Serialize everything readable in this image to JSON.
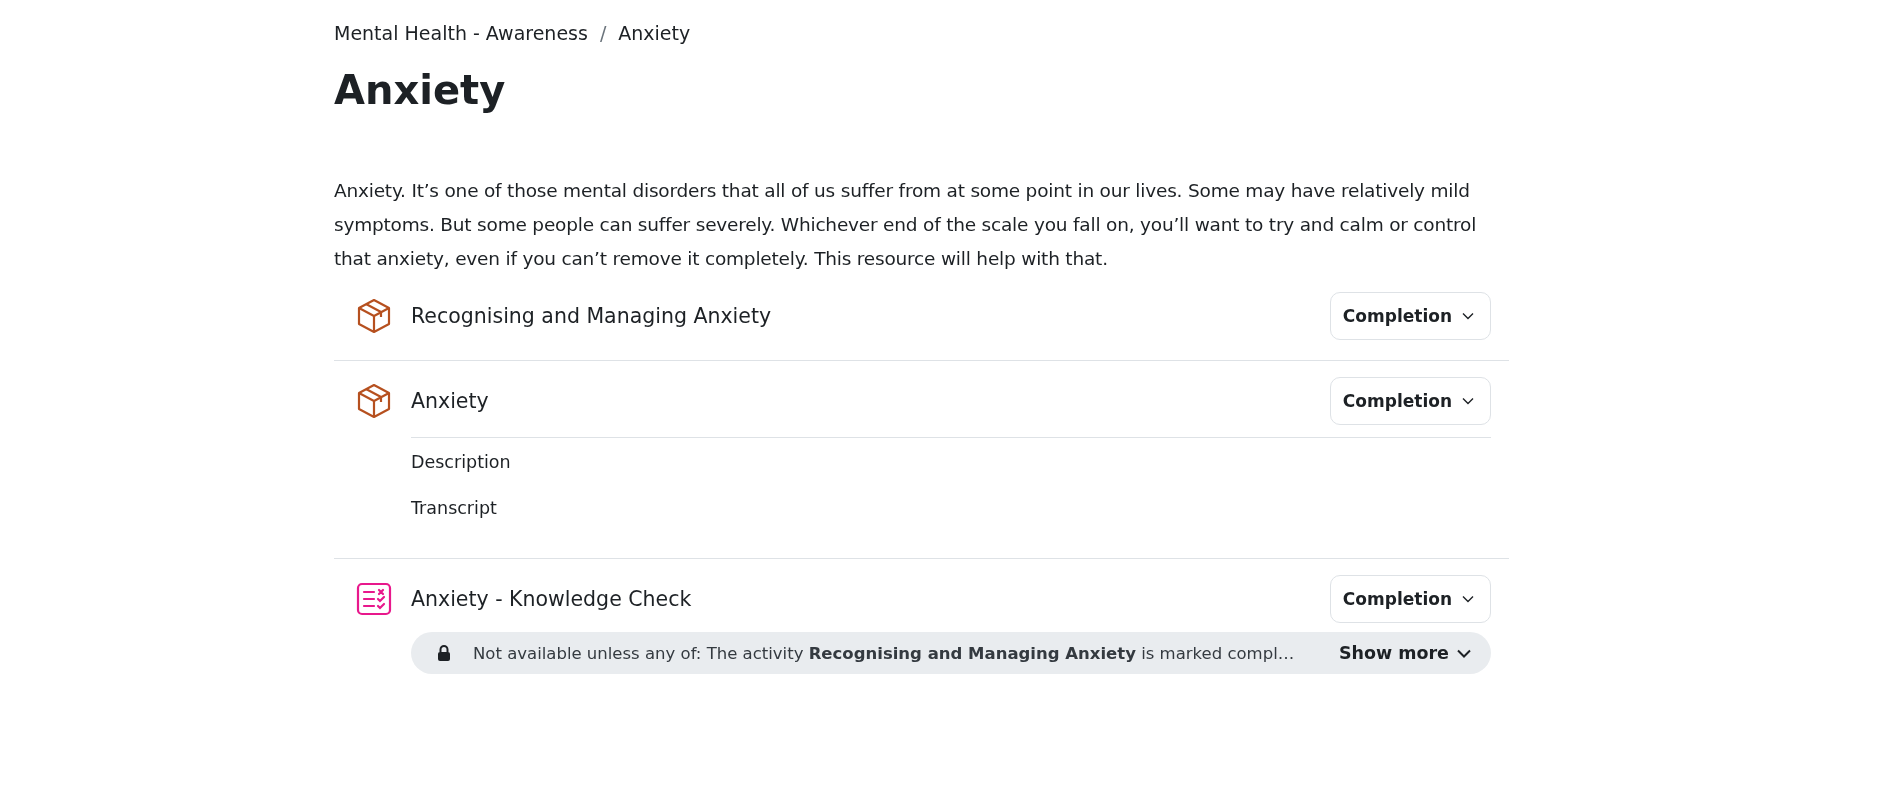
{
  "breadcrumb": {
    "items": [
      "Mental Health - Awareness",
      "Anxiety"
    ],
    "separator": "/"
  },
  "title": "Anxiety",
  "intro": "Anxiety. It’s one of those mental disorders that all of us suffer from at some point in our lives. Some may have relatively mild symptoms. But some people can suffer severely. Whichever end of the scale you fall on, you’ll want to try and calm or control that anxiety, even if you can’t remove it completely. This resource will help with that.",
  "activities": [
    {
      "kind": "package",
      "title": "Recognising and Managing Anxiety",
      "completion": "Completion"
    },
    {
      "kind": "package",
      "title": "Anxiety",
      "completion": "Completion",
      "links": [
        "Description",
        "Transcript"
      ]
    },
    {
      "kind": "quiz",
      "title": "Anxiety - Knowledge Check",
      "completion": "Completion",
      "restriction": {
        "text": "Not available unless any of: The activity **Recognising and Managing Anxiety** is marked compl…",
        "toggle": "Show more"
      }
    }
  ]
}
